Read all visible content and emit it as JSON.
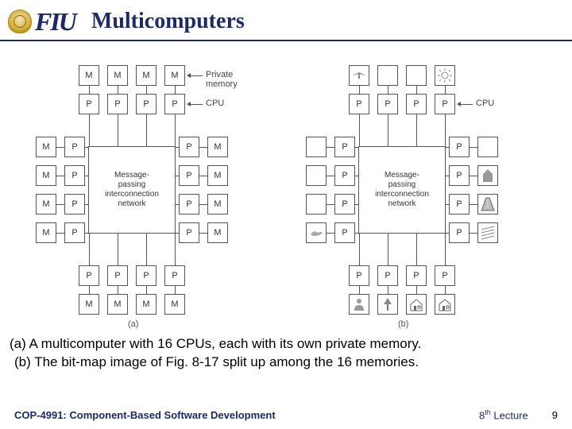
{
  "header": {
    "logo_text": "FIU",
    "title": "Multicomputers"
  },
  "diagram": {
    "box_M": "M",
    "box_P": "P",
    "center_text": "Message-\npassing\ninterconnection\nnetwork",
    "label_private_memory": "Private memory",
    "label_cpu": "CPU",
    "sublabel_a": "(a)",
    "sublabel_b": "(b)"
  },
  "captions": {
    "line_a": "(a) A multicomputer with 16 CPUs, each with its own private memory.",
    "line_b": "(b) The bit-map image of Fig. 8-17 split up among the 16 memories."
  },
  "footer": {
    "left": "COP-4991: Component-Based Software Development",
    "right_prefix": "8",
    "right_suffix": "Lecture",
    "page": "9"
  }
}
